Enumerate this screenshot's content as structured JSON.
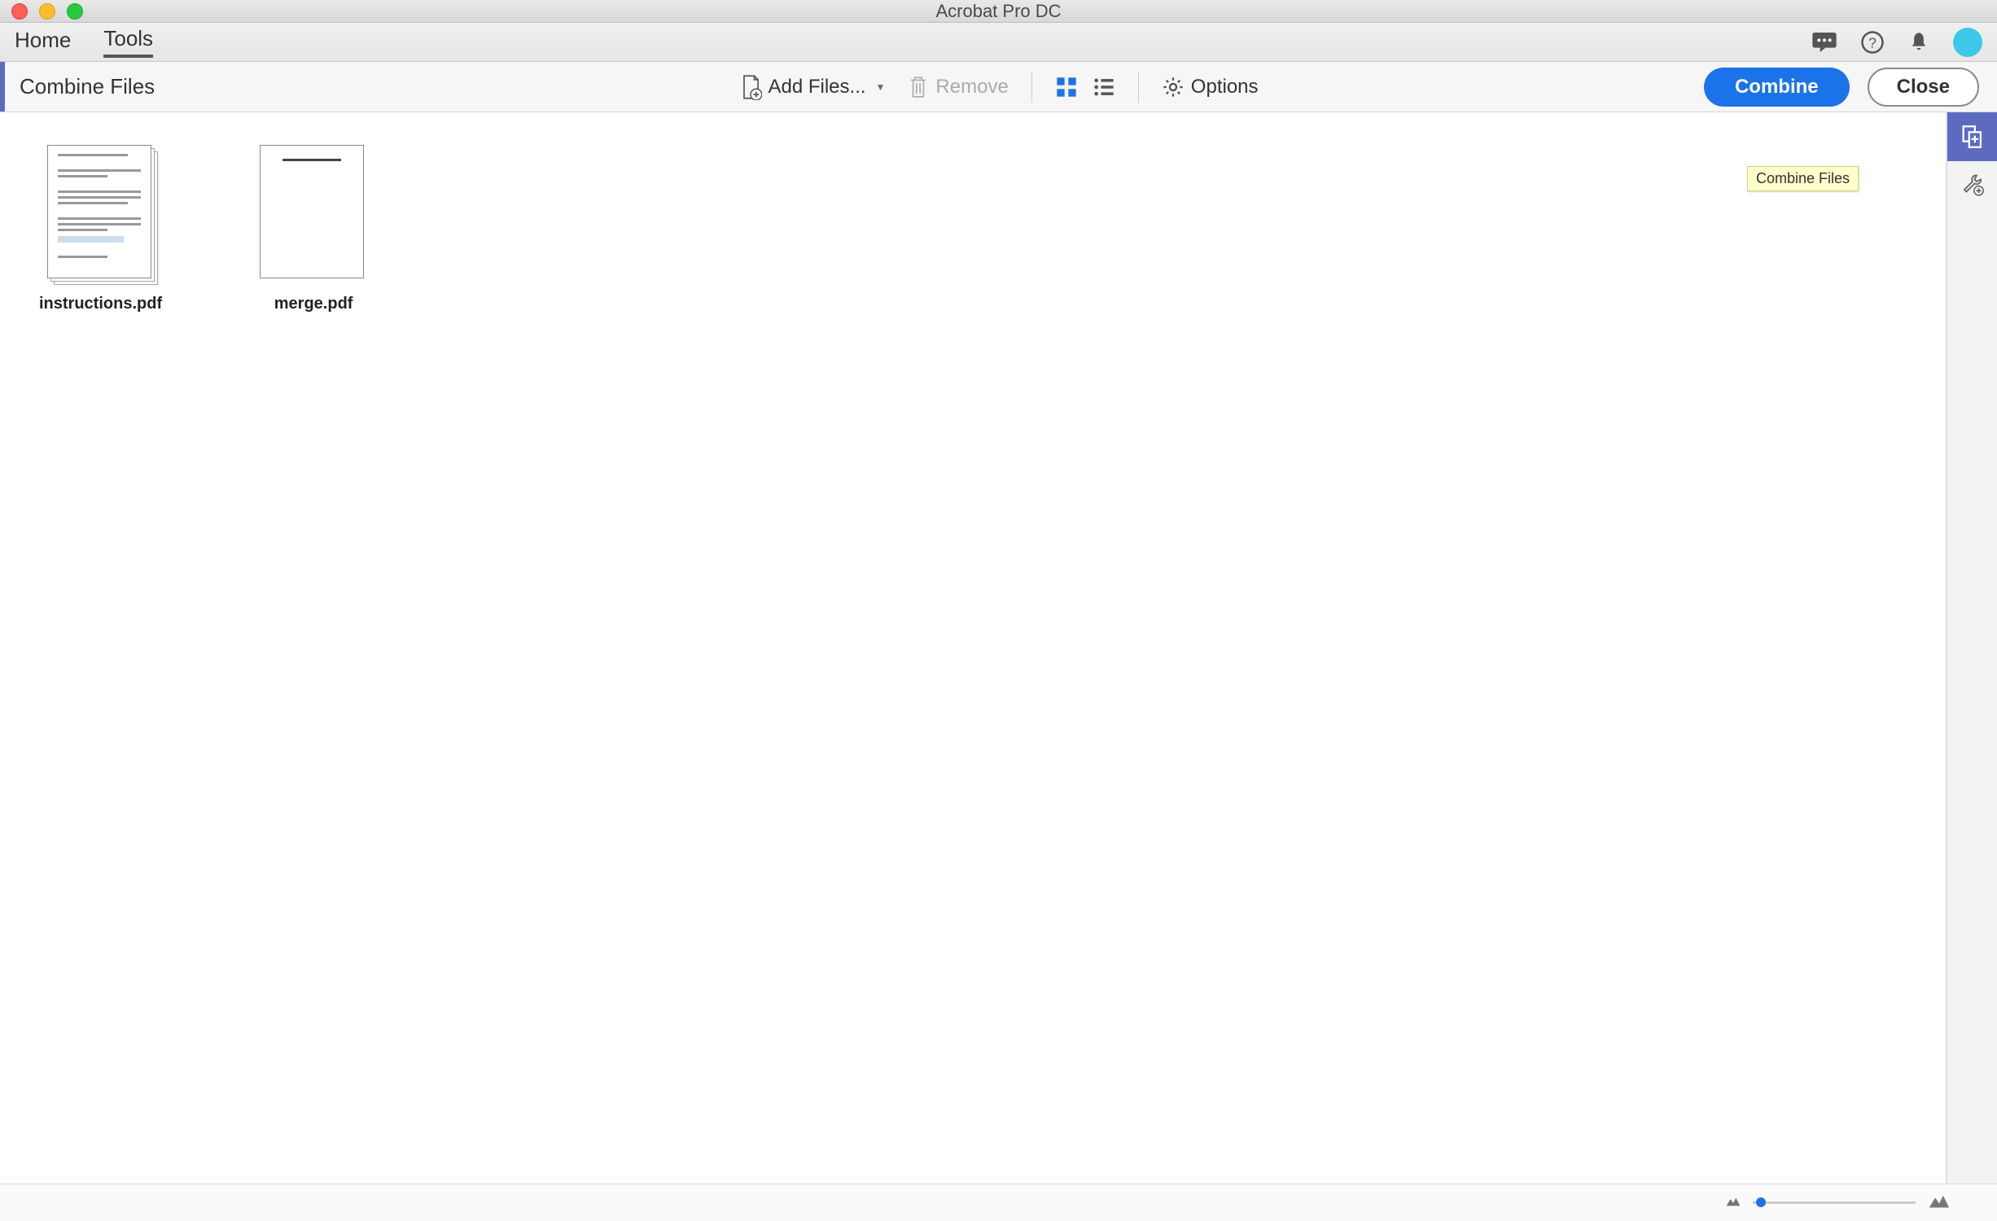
{
  "window": {
    "title": "Acrobat Pro DC"
  },
  "tabs": {
    "home": "Home",
    "tools": "Tools",
    "active": "tools"
  },
  "toolbar": {
    "title": "Combine Files",
    "add_files": "Add Files...",
    "remove": "Remove",
    "options": "Options",
    "combine": "Combine",
    "close": "Close"
  },
  "tooltip": {
    "combine_files": "Combine Files"
  },
  "files": [
    {
      "name": "instructions.pdf",
      "multi_page": true
    },
    {
      "name": "merge.pdf",
      "multi_page": false
    }
  ]
}
